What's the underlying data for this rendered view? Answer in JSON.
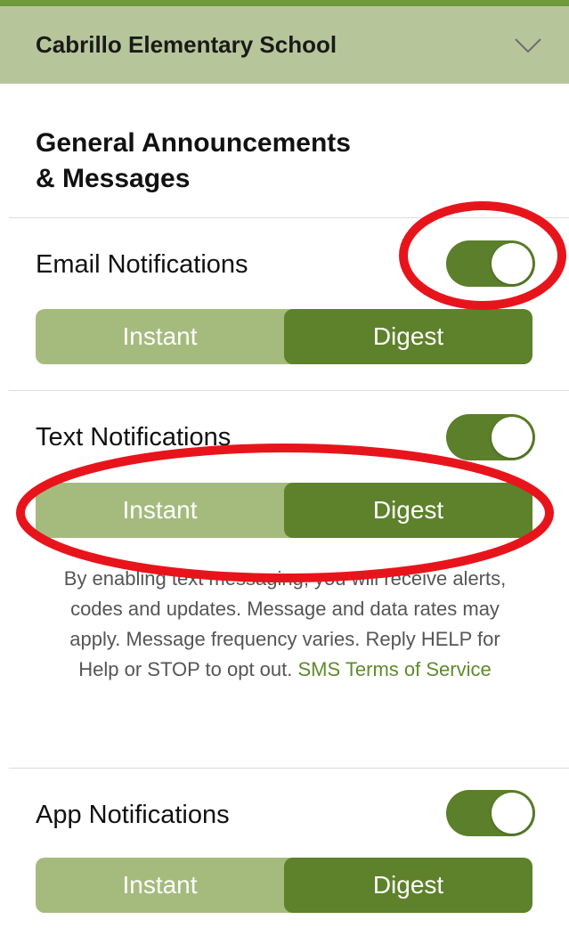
{
  "header": {
    "school_name": "Cabrillo Elementary School",
    "dropdown_icon": "chevron-down-icon"
  },
  "section": {
    "title_line1": "General Announcements",
    "title_line2": "& Messages"
  },
  "email": {
    "label": "Email Notifications",
    "enabled": true,
    "options": [
      "Instant",
      "Digest"
    ],
    "selected": "Digest"
  },
  "text": {
    "label": "Text Notifications",
    "enabled": true,
    "options": [
      "Instant",
      "Digest"
    ],
    "selected": "Digest",
    "disclaimer": "By enabling text messaging, you will receive alerts, codes and updates. Message and data rates may apply. Message frequency varies. Reply HELP for Help or STOP to opt out.",
    "terms_link": "SMS Terms of Service"
  },
  "app": {
    "label": "App Notifications",
    "enabled": true,
    "options": [
      "Instant",
      "Digest"
    ],
    "selected": "Digest"
  },
  "colors": {
    "header_bg": "#b6c69a",
    "accent_dark": "#5e812b",
    "accent_light": "#a5bb7e",
    "annotation_red": "#e8141c"
  }
}
